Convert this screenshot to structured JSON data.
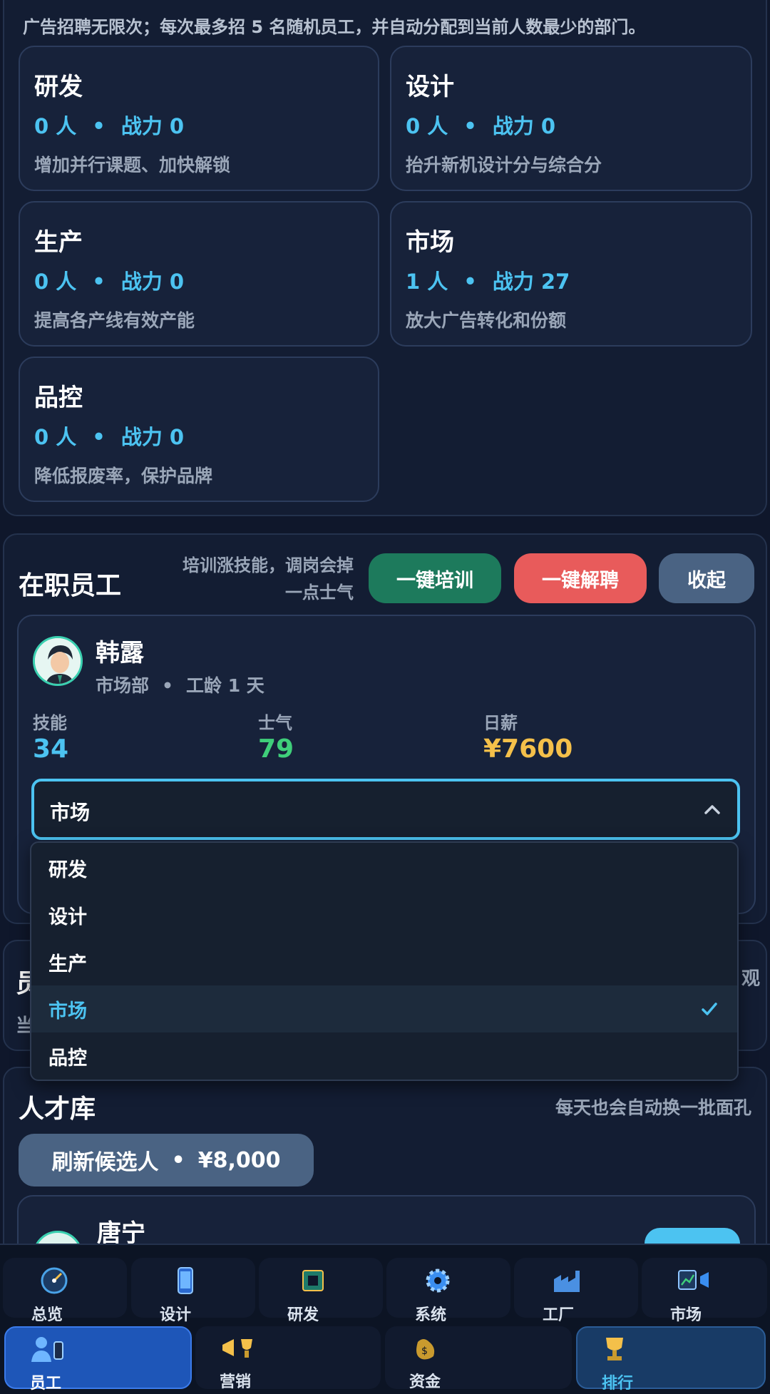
{
  "recruit_note": "广告招聘无限次；每次最多招 5 名随机员工，并自动分配到当前人数最少的部门。",
  "departments": [
    {
      "name": "研发",
      "count": "0 人",
      "power": "战力 0",
      "desc": "增加并行课题、加快解锁"
    },
    {
      "name": "设计",
      "count": "0 人",
      "power": "战力 0",
      "desc": "抬升新机设计分与综合分"
    },
    {
      "name": "生产",
      "count": "0 人",
      "power": "战力 0",
      "desc": "提高各产线有效产能"
    },
    {
      "name": "市场",
      "count": "1 人",
      "power": "战力 27",
      "desc": "放大广告转化和份额"
    },
    {
      "name": "品控",
      "count": "0 人",
      "power": "战力 0",
      "desc": "降低报废率，保护品牌"
    }
  ],
  "stats_separator": "•",
  "staff": {
    "title": "在职员工",
    "hint": "培训涨技能，调岗会掉一点士气",
    "hint_line1": "培训涨技能，调岗会掉",
    "hint_line2": "一点士气",
    "train_all": "一键培训",
    "fire_all": "一键解聘",
    "collapse": "收起",
    "employee": {
      "name": "韩露",
      "dept": "市场部",
      "tenure": "工龄 1 天",
      "skill_label": "技能",
      "skill": "34",
      "morale_label": "士气",
      "morale": "79",
      "salary_label": "日薪",
      "salary": "¥7600",
      "select_value": "市场",
      "options": [
        "研发",
        "设计",
        "生产",
        "市场",
        "品控"
      ],
      "selected_index": 3
    }
  },
  "hidden_panel": {
    "left_glyph": "员",
    "left_glyph2": "当",
    "right_glyph": "观"
  },
  "talent": {
    "title": "人才库",
    "hint": "每天也会自动换一批面孔",
    "refresh_label": "刷新候选人",
    "refresh_cost": "¥8,000",
    "candidate_name": "唐宁"
  },
  "nav_row1": [
    {
      "label": "总览",
      "icon": "dashboard-gauge-icon"
    },
    {
      "label": "设计",
      "icon": "smartphone-icon"
    },
    {
      "label": "研发",
      "icon": "chip-icon"
    },
    {
      "label": "系统",
      "icon": "gear-icon"
    },
    {
      "label": "工厂",
      "icon": "factory-icon"
    },
    {
      "label": "市场",
      "icon": "chart-megaphone-icon"
    }
  ],
  "nav_row2": [
    {
      "label": "员工",
      "icon": "person-phone-icon"
    },
    {
      "label": "营销",
      "icon": "megaphone-trophy-icon"
    },
    {
      "label": "资金",
      "icon": "money-bag-icon"
    },
    {
      "label": "排行",
      "icon": "trophy-icon"
    }
  ],
  "colors": {
    "accent_blue": "#4cc3f1",
    "morale_green": "#3fcf7a",
    "salary_gold": "#f4c04a",
    "train_green": "#1d7a5c",
    "fire_red": "#e85b5b",
    "collapse_slate": "#4a6383",
    "active_nav": "#1e56b8"
  }
}
